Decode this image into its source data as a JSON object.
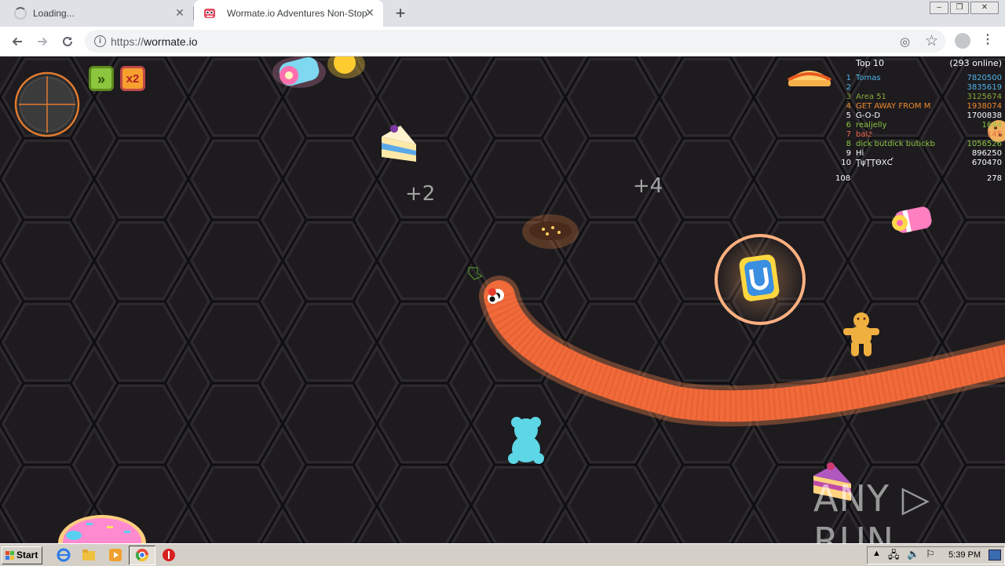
{
  "browser": {
    "tabs": [
      {
        "title": "Loading...",
        "state": "loading"
      },
      {
        "title": "Wormate.io Adventures Non-Stop",
        "state": "active"
      }
    ],
    "url_scheme": "https://",
    "url_host": "wormate.io",
    "new_tab_label": "+",
    "window_controls": {
      "minimize": "‒",
      "restore": "❐",
      "close": "✕"
    }
  },
  "game": {
    "leaderboard": {
      "title": "Top 10",
      "online": "(293 online)",
      "rows": [
        {
          "rank": "1",
          "name": "Tomas",
          "score": "7820500",
          "color": "#4fb3e8"
        },
        {
          "rank": "2",
          "name": "",
          "score": "3835619",
          "color": "#4fb3e8"
        },
        {
          "rank": "3",
          "name": "Area 51",
          "score": "3125674",
          "color": "#8aa838"
        },
        {
          "rank": "4",
          "name": "GET AWAY FROM M",
          "score": "1938074",
          "color": "#f08a30"
        },
        {
          "rank": "5",
          "name": "G-O-D",
          "score": "1700838",
          "color": "#ffffff"
        },
        {
          "rank": "6",
          "name": "realjelly",
          "score": "1644",
          "color": "#8cc63f"
        },
        {
          "rank": "7",
          "name": "balz",
          "score": "145",
          "color": "#f06a4a"
        },
        {
          "rank": "8",
          "name": "dick butdick butickb",
          "score": "1056526",
          "color": "#8cc63f"
        },
        {
          "rank": "9",
          "name": "Hi",
          "score": "896250",
          "color": "#ffffff"
        },
        {
          "rank": "10",
          "name": "ŢψŢŢƟXƇ",
          "score": "670470",
          "color": "#ffffff"
        }
      ],
      "my_rank": "108",
      "my_score": "278"
    },
    "floating_texts": [
      "+2",
      "+4"
    ],
    "powerups": [
      {
        "label": "»",
        "color": "#8cc63f",
        "icon": "speed-powerup-icon"
      },
      {
        "label": "x2",
        "color": "#f7a030",
        "icon": "multiplier-powerup-icon"
      }
    ],
    "watermark": "ANY ▷ RUN"
  },
  "taskbar": {
    "start_label": "Start",
    "clock": "5:39 PM"
  },
  "colors": {
    "worm": "#f06a3a",
    "game_bg": "#1d1b1e",
    "taskbar": "#d4d0c8"
  }
}
